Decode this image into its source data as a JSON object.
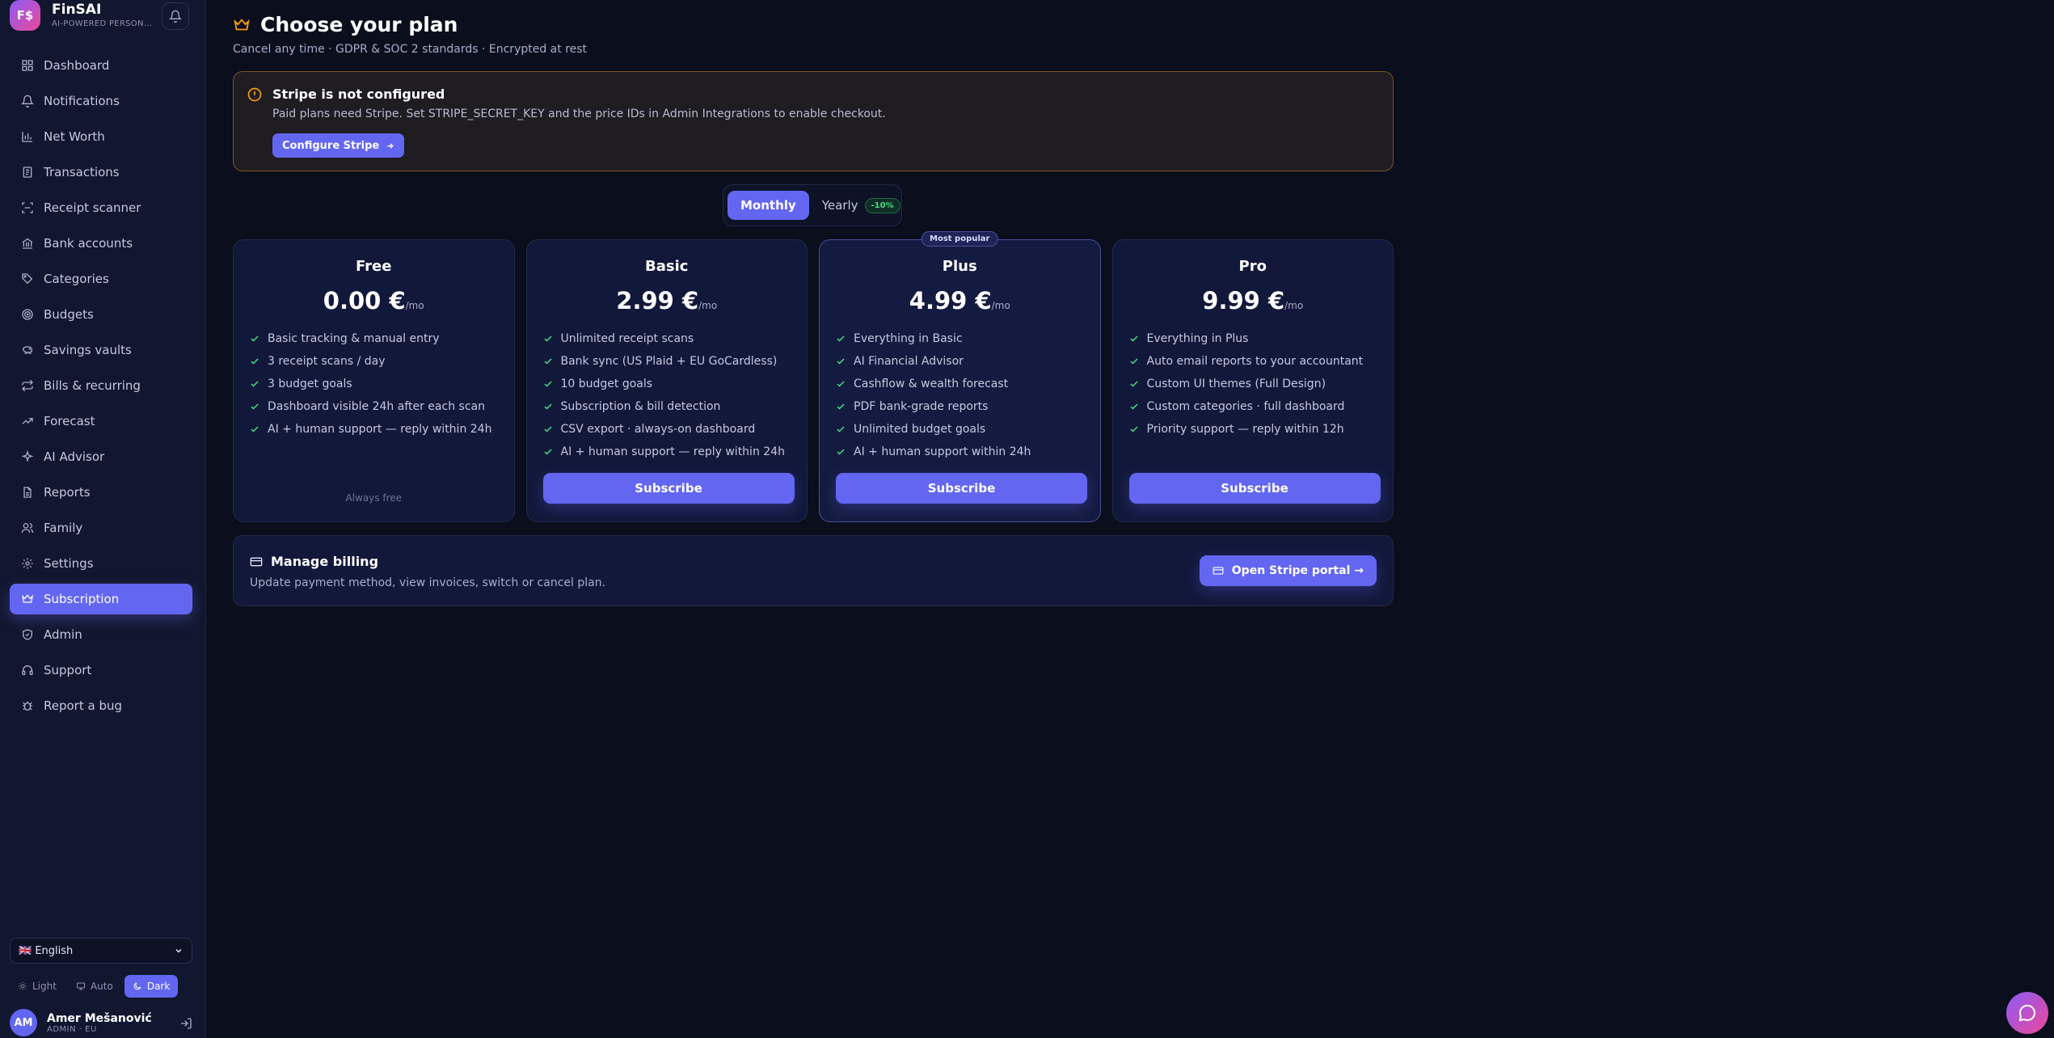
{
  "brand": {
    "logo": "F$",
    "name": "FinSAI",
    "tagline": "AI-POWERED PERSON..."
  },
  "sidebar": {
    "items": [
      {
        "label": "Dashboard",
        "icon": "grid-icon"
      },
      {
        "label": "Notifications",
        "icon": "bell-icon"
      },
      {
        "label": "Net Worth",
        "icon": "bar-chart-icon"
      },
      {
        "label": "Transactions",
        "icon": "receipt-icon"
      },
      {
        "label": "Receipt scanner",
        "icon": "scan-icon"
      },
      {
        "label": "Bank accounts",
        "icon": "bank-icon"
      },
      {
        "label": "Categories",
        "icon": "tag-icon"
      },
      {
        "label": "Budgets",
        "icon": "target-icon"
      },
      {
        "label": "Savings vaults",
        "icon": "piggy-bank-icon"
      },
      {
        "label": "Bills & recurring",
        "icon": "repeat-icon"
      },
      {
        "label": "Forecast",
        "icon": "trend-icon"
      },
      {
        "label": "AI Advisor",
        "icon": "sparkle-icon"
      },
      {
        "label": "Reports",
        "icon": "file-icon"
      },
      {
        "label": "Family",
        "icon": "users-icon"
      },
      {
        "label": "Settings",
        "icon": "gear-icon"
      },
      {
        "label": "Subscription",
        "icon": "crown-icon"
      },
      {
        "label": "Admin",
        "icon": "shield-icon"
      },
      {
        "label": "Support",
        "icon": "headset-icon"
      },
      {
        "label": "Report a bug",
        "icon": "bug-icon"
      }
    ],
    "active": "Subscription",
    "language": "🇬🇧 English",
    "theme": {
      "light": "Light",
      "auto": "Auto",
      "dark": "Dark",
      "selected": "Dark"
    },
    "user": {
      "initials": "AM",
      "name": "Amer Mešanović",
      "role": "ADMIN · EU"
    }
  },
  "header": {
    "title": "Choose your plan",
    "subtitle": "Cancel any time · GDPR & SOC 2 standards · Encrypted at rest"
  },
  "warning": {
    "title": "Stripe is not configured",
    "text": "Paid plans need Stripe. Set STRIPE_SECRET_KEY and the price IDs in Admin Integrations to enable checkout.",
    "button": "Configure Stripe"
  },
  "billing_toggle": {
    "monthly": "Monthly",
    "yearly": "Yearly",
    "yearly_badge": "-10%",
    "selected": "Monthly"
  },
  "plans": [
    {
      "name": "Free",
      "price": "0.00 €",
      "period": "/mo",
      "features": [
        "Basic tracking & manual entry",
        "3 receipt scans / day",
        "3 budget goals",
        "Dashboard visible 24h after each scan",
        "AI + human support — reply within 24h"
      ],
      "note": "Always free"
    },
    {
      "name": "Basic",
      "price": "2.99 €",
      "period": "/mo",
      "features": [
        "Unlimited receipt scans",
        "Bank sync (US Plaid + EU GoCardless)",
        "10 budget goals",
        "Subscription & bill detection",
        "CSV export · always-on dashboard",
        "AI + human support — reply within 24h"
      ],
      "button": "Subscribe"
    },
    {
      "name": "Plus",
      "price": "4.99 €",
      "period": "/mo",
      "badge": "Most popular",
      "features": [
        "Everything in Basic",
        "AI Financial Advisor",
        "Cashflow & wealth forecast",
        "PDF bank-grade reports",
        "Unlimited budget goals",
        "AI + human support within 24h"
      ],
      "button": "Subscribe"
    },
    {
      "name": "Pro",
      "price": "9.99 €",
      "period": "/mo",
      "features": [
        "Everything in Plus",
        "Auto email reports to your accountant",
        "Custom UI themes (Full Design)",
        "Custom categories · full dashboard",
        "Priority support — reply within 12h"
      ],
      "button": "Subscribe"
    }
  ],
  "manage_billing": {
    "title": "Manage billing",
    "text": "Update payment method, view invoices, switch or cancel plan.",
    "button": "Open Stripe portal →"
  },
  "colors": {
    "accent": "#6366f1",
    "success": "#4ade80",
    "warning": "#f59e0b",
    "background": "#0a0e1d"
  }
}
